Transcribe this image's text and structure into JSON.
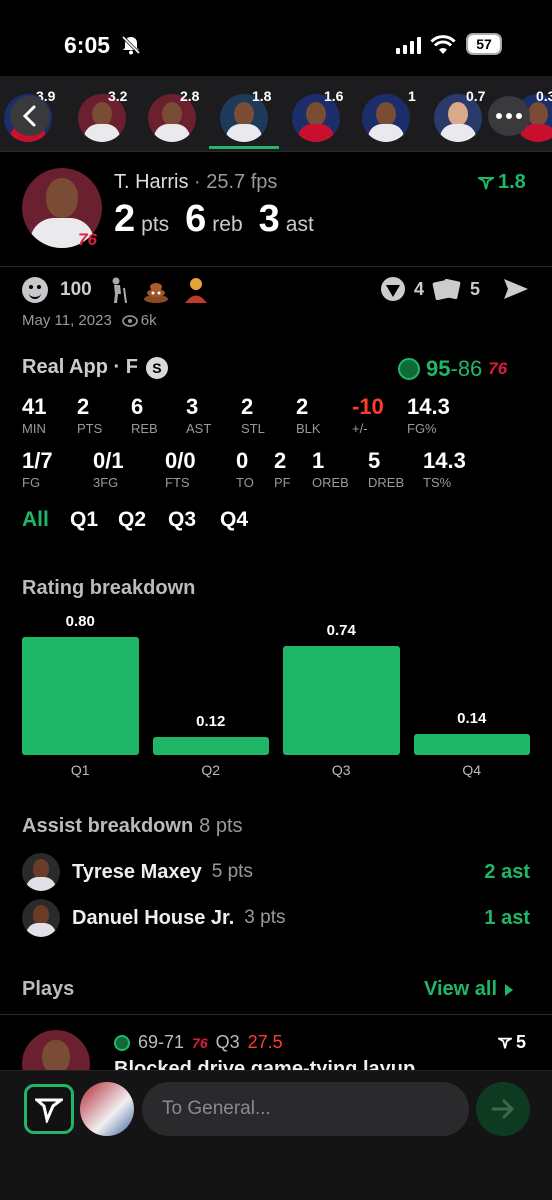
{
  "status_bar": {
    "time": "6:05",
    "battery": "57"
  },
  "player_strip": {
    "values": [
      "3.9",
      "3.2",
      "2.8",
      "1.8",
      "1.6",
      "1",
      "0.7",
      "0.3"
    ],
    "selected_index": 3
  },
  "player": {
    "name": "T. Harris",
    "fps": "· 25.7 fps",
    "pts": "2",
    "pts_label": "pts",
    "reb": "6",
    "reb_label": "reb",
    "ast": "3",
    "ast_label": "ast",
    "rating": "1.8",
    "team_logo_text": "76"
  },
  "reactions": {
    "emoji_count": "100",
    "right_count_1": "4",
    "right_count_2": "5"
  },
  "post": {
    "date": "May 11, 2023",
    "views": "6k"
  },
  "game": {
    "title": "Real App · F",
    "badge": "S",
    "away_score": "95",
    "separator": "-",
    "home_score": "86",
    "home_logo_text": "76",
    "stats_row1": [
      {
        "v": "41",
        "k": "MIN"
      },
      {
        "v": "2",
        "k": "PTS"
      },
      {
        "v": "6",
        "k": "REB"
      },
      {
        "v": "3",
        "k": "AST"
      },
      {
        "v": "2",
        "k": "STL"
      },
      {
        "v": "2",
        "k": "BLK"
      },
      {
        "v": "-10",
        "k": "+/-"
      },
      {
        "v": "14.3",
        "k": "FG%"
      }
    ],
    "stats_row2": [
      {
        "v": "1/7",
        "k": "FG"
      },
      {
        "v": "0/1",
        "k": "3FG"
      },
      {
        "v": "0/0",
        "k": "FTS"
      },
      {
        "v": "0",
        "k": "TO"
      },
      {
        "v": "2",
        "k": "PF"
      },
      {
        "v": "1",
        "k": "OREB"
      },
      {
        "v": "5",
        "k": "DREB"
      },
      {
        "v": "14.3",
        "k": "TS%"
      }
    ],
    "tabs": [
      "All",
      "Q1",
      "Q2",
      "Q3",
      "Q4"
    ]
  },
  "rating_breakdown": {
    "title": "Rating breakdown"
  },
  "chart_data": {
    "type": "bar",
    "title": "Rating breakdown",
    "categories": [
      "Q1",
      "Q2",
      "Q3",
      "Q4"
    ],
    "values": [
      0.8,
      0.12,
      0.74,
      0.14
    ],
    "value_labels": [
      "0.80",
      "0.12",
      "0.74",
      "0.14"
    ],
    "ylim": [
      0,
      0.8
    ],
    "color": "#1fb767"
  },
  "assist_breakdown": {
    "title": "Assist breakdown",
    "subtitle": "8 pts",
    "items": [
      {
        "name": "Tyrese Maxey",
        "pts": "5 pts",
        "ast": "2 ast"
      },
      {
        "name": "Danuel House Jr.",
        "pts": "3 pts",
        "ast": "1 ast"
      }
    ]
  },
  "plays": {
    "title": "Plays",
    "view_all": "View all",
    "item": {
      "score": "69-71",
      "home_logo_text": "76",
      "quarter": "Q3",
      "time": "27.5",
      "rating": "5",
      "desc": "Blocked drive game-tying layup"
    }
  },
  "composer": {
    "placeholder": "To General..."
  },
  "colors": {
    "accent": "#1fb767",
    "negative": "#ff3b30",
    "background": "#000000"
  }
}
